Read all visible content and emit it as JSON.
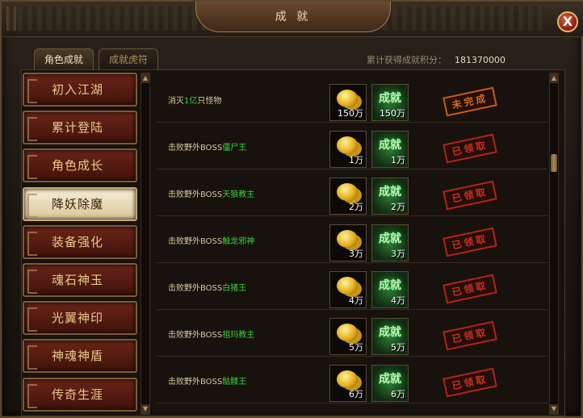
{
  "window": {
    "title": "成 就",
    "close_label": "X"
  },
  "tabs": [
    {
      "label": "角色成就",
      "active": true
    },
    {
      "label": "成就虎符",
      "active": false
    }
  ],
  "score": {
    "label": "累计获得成就积分：",
    "value": "181370000"
  },
  "categories": [
    {
      "label": "初入江湖",
      "active": false
    },
    {
      "label": "累计登陆",
      "active": false
    },
    {
      "label": "角色成长",
      "active": false
    },
    {
      "label": "降妖除魔",
      "active": true
    },
    {
      "label": "装备强化",
      "active": false
    },
    {
      "label": "魂石神玉",
      "active": false
    },
    {
      "label": "光翼神印",
      "active": false
    },
    {
      "label": "神魂神盾",
      "active": false
    },
    {
      "label": "传奇生涯",
      "active": false
    }
  ],
  "achievements": [
    {
      "prefix": "消灭",
      "highlight": "1亿",
      "suffix": "只怪物",
      "gold": "150万",
      "jade_label": "成就",
      "jade": "150万",
      "status": "未完成"
    },
    {
      "prefix": "击败野外BOSS",
      "highlight": "僵尸王",
      "suffix": "",
      "gold": "1万",
      "jade_label": "成就",
      "jade": "1万",
      "status": "已领取"
    },
    {
      "prefix": "击败野外BOSS",
      "highlight": "天狼教主",
      "suffix": "",
      "gold": "2万",
      "jade_label": "成就",
      "jade": "2万",
      "status": "已领取"
    },
    {
      "prefix": "击败野外BOSS",
      "highlight": "触龙邪神",
      "suffix": "",
      "gold": "3万",
      "jade_label": "成就",
      "jade": "3万",
      "status": "已领取"
    },
    {
      "prefix": "击败野外BOSS",
      "highlight": "白猪王",
      "suffix": "",
      "gold": "4万",
      "jade_label": "成就",
      "jade": "4万",
      "status": "已领取"
    },
    {
      "prefix": "击败野外BOSS",
      "highlight": "祖玛教主",
      "suffix": "",
      "gold": "5万",
      "jade_label": "成就",
      "jade": "5万",
      "status": "已领取"
    },
    {
      "prefix": "击败野外BOSS",
      "highlight": "骷髅王",
      "suffix": "",
      "gold": "6万",
      "jade_label": "成就",
      "jade": "6万",
      "status": "已领取"
    }
  ],
  "colors": {
    "accent": "#3ad13a",
    "stamp_red": "#c8301e",
    "stamp_orange": "#d26a22"
  }
}
